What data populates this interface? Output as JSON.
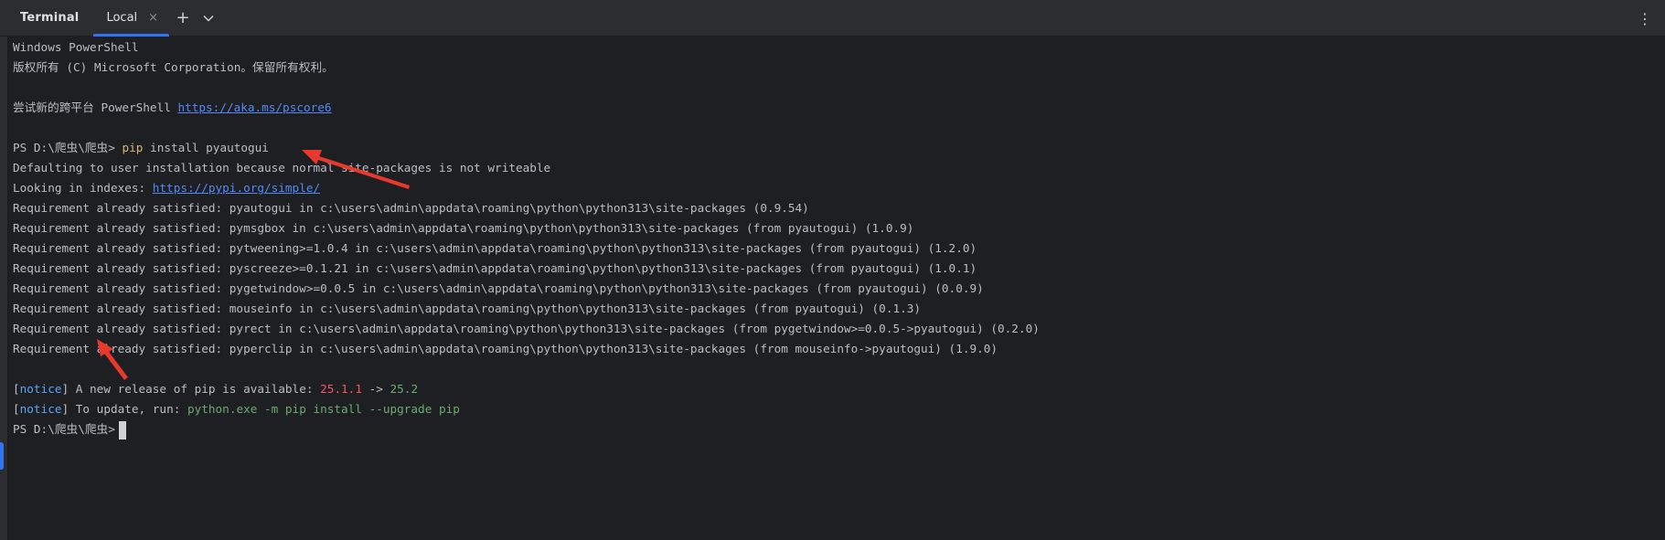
{
  "toolbar": {
    "title": "Terminal",
    "tab_label": "Local",
    "close_glyph": "×",
    "add_glyph": "+",
    "dropdown_glyph": "⌄",
    "more_glyph": "⋮"
  },
  "console": {
    "header1": "Windows PowerShell",
    "header2": "版权所有 (C) Microsoft Corporation。保留所有权利。",
    "try_prefix": "尝试新的跨平台 PowerShell ",
    "try_link": "https://aka.ms/pscore6",
    "prompt": "PS D:\\爬虫\\爬虫> ",
    "cmd_word": "pip",
    "cmd_rest": " install pyautogui",
    "defaulting": "Defaulting to user installation because normal site-packages is not writeable",
    "looking_prefix": "Looking in indexes: ",
    "looking_link": "https://pypi.org/simple/",
    "requirements": [
      "Requirement already satisfied: pyautogui in c:\\users\\admin\\appdata\\roaming\\python\\python313\\site-packages (0.9.54)",
      "Requirement already satisfied: pymsgbox in c:\\users\\admin\\appdata\\roaming\\python\\python313\\site-packages (from pyautogui) (1.0.9)",
      "Requirement already satisfied: pytweening>=1.0.4 in c:\\users\\admin\\appdata\\roaming\\python\\python313\\site-packages (from pyautogui) (1.2.0)",
      "Requirement already satisfied: pyscreeze>=0.1.21 in c:\\users\\admin\\appdata\\roaming\\python\\python313\\site-packages (from pyautogui) (1.0.1)",
      "Requirement already satisfied: pygetwindow>=0.0.5 in c:\\users\\admin\\appdata\\roaming\\python\\python313\\site-packages (from pyautogui) (0.0.9)",
      "Requirement already satisfied: mouseinfo in c:\\users\\admin\\appdata\\roaming\\python\\python313\\site-packages (from pyautogui) (0.1.3)",
      "Requirement already satisfied: pyrect in c:\\users\\admin\\appdata\\roaming\\python\\python313\\site-packages (from pygetwindow>=0.0.5->pyautogui) (0.2.0)",
      "Requirement already satisfied: pyperclip in c:\\users\\admin\\appdata\\roaming\\python\\python313\\site-packages (from mouseinfo->pyautogui) (1.9.0)"
    ],
    "bracket_open": "[",
    "bracket_close": "]",
    "notice_word": "notice",
    "notice1_text": " A new release of pip is available: ",
    "old_version": "25.1.1",
    "arrow_text": " -> ",
    "new_version": "25.2",
    "notice2_text": " To update, run: ",
    "update_cmd": "python.exe -m pip install --upgrade pip",
    "final_prompt": "PS D:\\爬虫\\爬虫>"
  },
  "colors": {
    "background": "#1e1f22",
    "toolbar": "#2b2d30",
    "accent": "#3574f0",
    "link": "#548af7",
    "command": "#d5b778",
    "notice": "#56a8f5",
    "old_version": "#f75464",
    "new_version": "#6aab73",
    "annotation_arrow": "#e8392c"
  }
}
